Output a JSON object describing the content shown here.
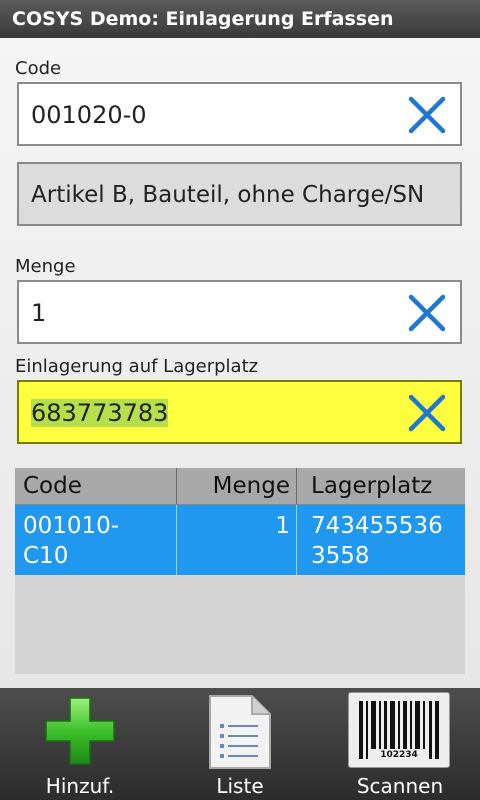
{
  "title": "COSYS Demo: Einlagerung Erfassen",
  "code": {
    "label": "Code",
    "value": "001020-0"
  },
  "article": {
    "value": "Artikel B, Bauteil, ohne Charge/SN"
  },
  "menge": {
    "label": "Menge",
    "value": "1"
  },
  "lagerplatz": {
    "label": "Einlagerung auf Lagerplatz",
    "value": "683773783"
  },
  "table": {
    "headers": {
      "code": "Code",
      "menge": "Menge",
      "lagerplatz": "Lagerplatz"
    },
    "rows": [
      {
        "code_line1": "001010-",
        "code_line2": "C10",
        "menge": "1",
        "lagerplatz_line1": "743455536",
        "lagerplatz_line2": "3558"
      }
    ]
  },
  "toolbar": {
    "add_label": "Hinzuf.",
    "list_label": "Liste",
    "scan_label": "Scannen",
    "barcode_number": "102234"
  },
  "colors": {
    "clear_icon": "#1e78d2",
    "highlight_field": "#ffff40",
    "selected_row": "#2098f0"
  }
}
